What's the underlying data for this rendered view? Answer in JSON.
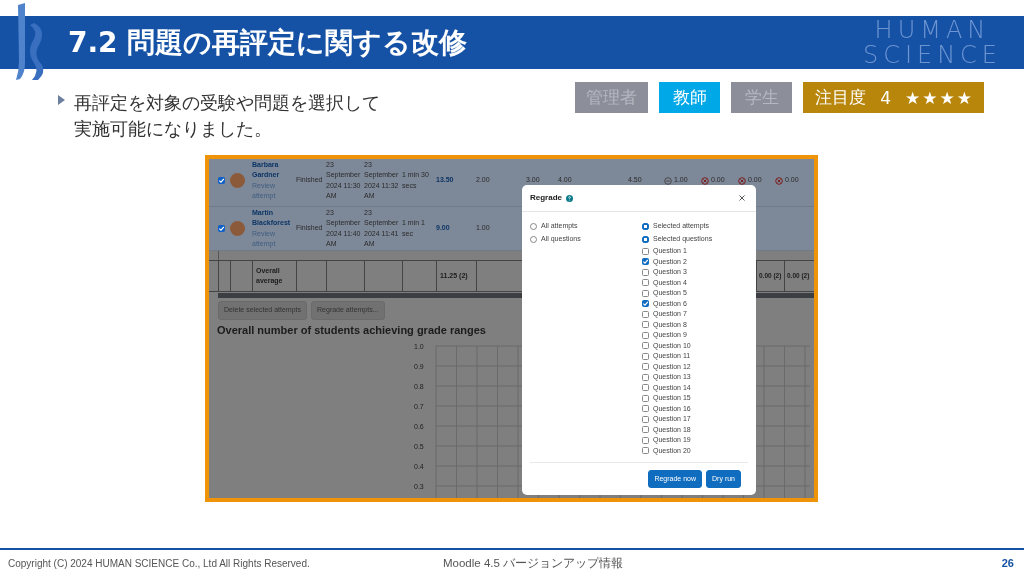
{
  "header": {
    "title": "7.2 問題の再評定に関する改修",
    "brand": [
      "HUMAN",
      "SCIENCE"
    ]
  },
  "bullet": {
    "lines": [
      "再評定を対象の受験や問題を選択して",
      "実施可能になりました。"
    ]
  },
  "roles": [
    {
      "label": "管理者",
      "selected": false
    },
    {
      "label": "教師",
      "selected": true
    },
    {
      "label": "学生",
      "selected": false
    }
  ],
  "rating": {
    "label": "注目度",
    "value": "4",
    "stars": 4
  },
  "screenshot": {
    "attempts": [
      {
        "checked": true,
        "name": [
          "Barbara",
          "Gardner"
        ],
        "review": [
          "Review",
          "attempt"
        ],
        "state": "Finished",
        "started": [
          "23",
          "September",
          "2024 11:30",
          "AM"
        ],
        "completed": [
          "23",
          "September",
          "2024 11:32",
          "AM"
        ],
        "duration": [
          "1 min 30",
          "secs"
        ],
        "grade": "13.50",
        "marks": [
          "2.00",
          "3.00",
          "4.00",
          "4.50"
        ],
        "right_marks": [
          {
            "kind": "partial",
            "value": "1.00"
          },
          {
            "kind": "incorrect",
            "value": "0.00"
          },
          {
            "kind": "incorrect",
            "value": "0.00"
          },
          {
            "kind": "incorrect",
            "value": "0.00"
          }
        ]
      },
      {
        "checked": true,
        "name": [
          "Martin",
          "Blackforest"
        ],
        "review": [
          "Review",
          "attempt"
        ],
        "state": "Finished",
        "started": [
          "23",
          "September",
          "2024 11:40",
          "AM"
        ],
        "completed": [
          "23",
          "September",
          "2024 11:41",
          "AM"
        ],
        "duration": [
          "1 min 1",
          "sec"
        ],
        "grade": "9.00",
        "marks": [
          "1.00"
        ]
      }
    ],
    "overall": {
      "label": [
        "Overall",
        "average"
      ],
      "grade": "11.25 (2)",
      "right": [
        "0.00 (2)",
        "0.00 (2)"
      ]
    },
    "buttons": [
      "Delete selected attempts",
      "Regrade attempts..."
    ],
    "heading": "Overall number of students achieving grade ranges",
    "y_ticks": [
      "1.0",
      "0.9",
      "0.8",
      "0.7",
      "0.6",
      "0.5",
      "0.4",
      "0.3"
    ],
    "modal": {
      "title": "Regrade",
      "options": [
        [
          {
            "label": "All attempts",
            "selected": false
          },
          {
            "label": "Selected attempts",
            "selected": true
          }
        ],
        [
          {
            "label": "All questions",
            "selected": false
          },
          {
            "label": "Selected questions",
            "selected": true
          }
        ]
      ],
      "questions": [
        {
          "label": "Question 1",
          "checked": false
        },
        {
          "label": "Question 2",
          "checked": true
        },
        {
          "label": "Question 3",
          "checked": false
        },
        {
          "label": "Question 4",
          "checked": false
        },
        {
          "label": "Question 5",
          "checked": false
        },
        {
          "label": "Question 6",
          "checked": true
        },
        {
          "label": "Question 7",
          "checked": false
        },
        {
          "label": "Question 8",
          "checked": false
        },
        {
          "label": "Question 9",
          "checked": false
        },
        {
          "label": "Question 10",
          "checked": false
        },
        {
          "label": "Question 11",
          "checked": false
        },
        {
          "label": "Question 12",
          "checked": false
        },
        {
          "label": "Question 13",
          "checked": false
        },
        {
          "label": "Question 14",
          "checked": false
        },
        {
          "label": "Question 15",
          "checked": false
        },
        {
          "label": "Question 16",
          "checked": false
        },
        {
          "label": "Question 17",
          "checked": false
        },
        {
          "label": "Question 18",
          "checked": false
        },
        {
          "label": "Question 19",
          "checked": false
        },
        {
          "label": "Question 20",
          "checked": false
        }
      ],
      "buttons": [
        "Regrade now",
        "Dry run"
      ]
    }
  },
  "footer": {
    "copyright": "Copyright (C) 2024 HUMAN SCIENCE Co., Ltd All Rights Reserved.",
    "topic": "Moodle 4.5 バージョンアップ情報",
    "page": "26"
  }
}
